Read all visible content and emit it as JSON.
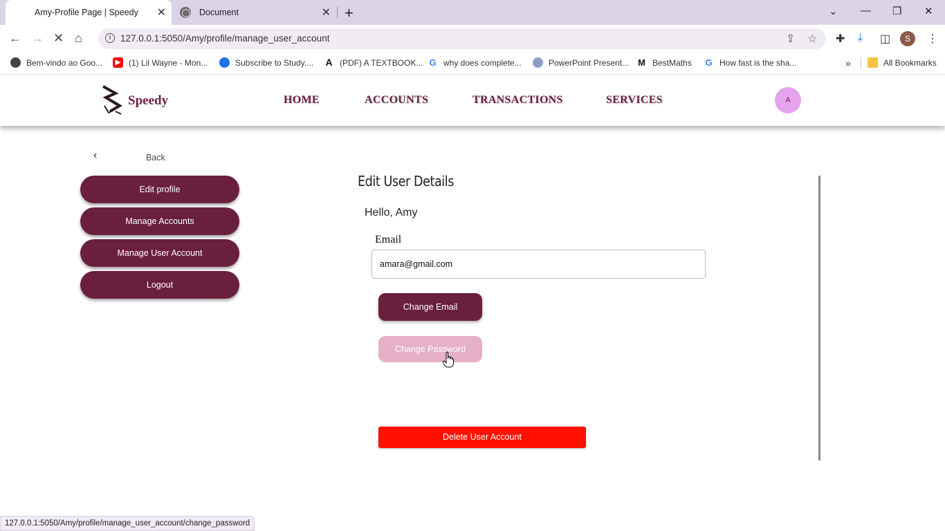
{
  "browser": {
    "tabs": [
      {
        "title": "Amy-Profile Page | Speedy",
        "active": true
      },
      {
        "title": "Document",
        "active": false
      }
    ],
    "url": "127.0.0.1:5050/Amy/profile/manage_user_account",
    "bookmarks": [
      {
        "label": "Bem-vindo ao Goo...",
        "icon": "globe-icon"
      },
      {
        "label": "(1) Lil Wayne - Mon...",
        "icon": "youtube-icon"
      },
      {
        "label": "Subscribe to Study....",
        "icon": "study-icon"
      },
      {
        "label": "(PDF) A TEXTBOOK...",
        "icon": "academia-icon"
      },
      {
        "label": "why does complete...",
        "icon": "google-icon"
      },
      {
        "label": "PowerPoint Present...",
        "icon": "slides-icon"
      },
      {
        "label": "BestMaths",
        "icon": "bestmaths-icon"
      },
      {
        "label": "How fast is the sha...",
        "icon": "google-icon"
      }
    ],
    "all_bookmarks": "All Bookmarks",
    "profile_initial": "S",
    "status_url": "127.0.0.1:5050/Amy/profile/manage_user_account/change_password"
  },
  "site": {
    "brand": "Speedy",
    "nav": [
      "HOME",
      "ACCOUNTS",
      "TRANSACTIONS",
      "SERVICES"
    ],
    "avatar_initial": "A"
  },
  "sidebar": {
    "back_label": "Back",
    "items": [
      "Edit profile",
      "Manage Accounts",
      "Manage User Account",
      "Logout"
    ]
  },
  "panel": {
    "title": "Edit User Details",
    "greeting": "Hello, Amy",
    "email_label": "Email",
    "email_value": "amara@gmail.com",
    "change_email": "Change Email",
    "change_password": "Change Password",
    "delete_account": "Delete User Account"
  },
  "colors": {
    "brand": "#6a1f3f",
    "avatar": "#e6a3ee",
    "change_password_hover": "#e6b0c8",
    "danger": "#ff1100"
  }
}
